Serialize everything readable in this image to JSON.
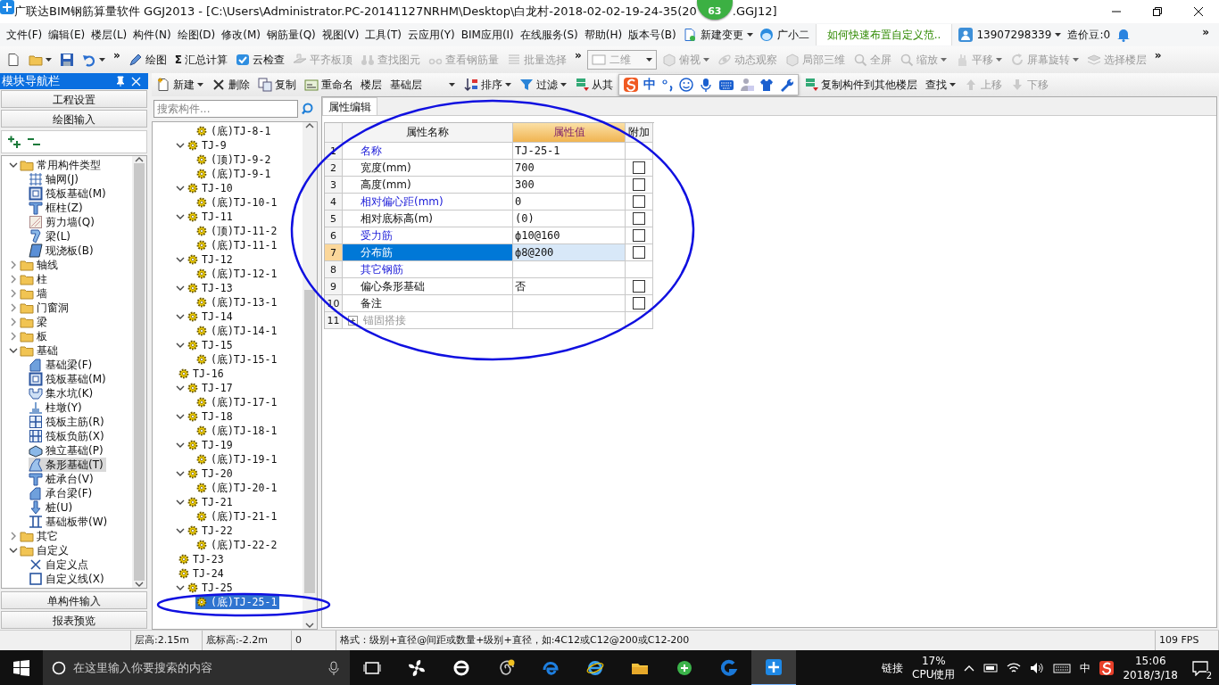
{
  "window": {
    "title": "广联达BIM钢筋算量软件 GGJ2013 - [C:\\Users\\Administrator.PC-20141127NRHM\\Desktop\\白龙村-2018-02-02-19-24-35(20",
    "title_end": ".GGJ12]",
    "badge": "63"
  },
  "menu": {
    "items": [
      "文件(F)",
      "编辑(E)",
      "楼层(L)",
      "构件(N)",
      "绘图(D)",
      "修改(M)",
      "钢筋量(Q)",
      "视图(V)",
      "工具(T)",
      "云应用(Y)",
      "BIM应用(I)",
      "在线服务(S)",
      "帮助(H)",
      "版本号(B)"
    ],
    "change_button": "新建变更",
    "assistant": "广小二",
    "tip": "如何快速布置自定义范..",
    "account": "13907298339",
    "beans": "造价豆:0",
    "overflow": "»"
  },
  "toolbar": {
    "items": [
      {
        "kind": "icon",
        "dropdown": false,
        "disabled": false
      },
      {
        "kind": "icon",
        "dropdown": true,
        "disabled": false
      },
      {
        "kind": "icon",
        "dropdown": false,
        "disabled": false
      },
      {
        "kind": "icon",
        "dropdown": true,
        "disabled": false
      },
      {
        "kind": "more",
        "label": "»"
      },
      {
        "kind": "button",
        "label": "绘图",
        "dropdown": false,
        "disabled": false
      },
      {
        "kind": "button",
        "symbol": "Σ",
        "label": "汇总计算",
        "dropdown": false,
        "disabled": false
      },
      {
        "kind": "button",
        "label": "云检查",
        "dropdown": false,
        "disabled": false
      },
      {
        "kind": "button",
        "label": "平齐板顶",
        "dropdown": false,
        "disabled": true
      },
      {
        "kind": "button",
        "label": "查找图元",
        "dropdown": false,
        "disabled": true
      },
      {
        "kind": "button",
        "label": "查看钢筋量",
        "dropdown": false,
        "disabled": true
      },
      {
        "kind": "button",
        "label": "批量选择",
        "dropdown": false,
        "disabled": true
      },
      {
        "kind": "more",
        "label": "»"
      },
      {
        "kind": "select",
        "label": "二维",
        "disabled": true
      },
      {
        "kind": "button",
        "label": "俯视",
        "dropdown": true,
        "disabled": true
      },
      {
        "kind": "button",
        "label": "动态观察",
        "dropdown": false,
        "disabled": true
      },
      {
        "kind": "button",
        "label": "局部三维",
        "dropdown": false,
        "disabled": true
      },
      {
        "kind": "button",
        "label": "全屏",
        "dropdown": false,
        "disabled": true
      },
      {
        "kind": "button",
        "label": "缩放",
        "dropdown": true,
        "disabled": true
      },
      {
        "kind": "button",
        "label": "平移",
        "dropdown": true,
        "disabled": true
      },
      {
        "kind": "button",
        "label": "屏幕旋转",
        "dropdown": true,
        "disabled": true
      },
      {
        "kind": "button",
        "label": "选择楼层",
        "dropdown": false,
        "disabled": true
      },
      {
        "kind": "more",
        "label": "»"
      }
    ]
  },
  "nav": {
    "title": "模块导航栏",
    "sections": [
      "工程设置",
      "绘图输入"
    ],
    "tree": [
      {
        "label": "常用构件类型",
        "expanded": true,
        "selected": false,
        "children": [
          {
            "label": "轴网(J)",
            "selected": false
          },
          {
            "label": "筏板基础(M)",
            "selected": false
          },
          {
            "label": "框柱(Z)",
            "selected": false
          },
          {
            "label": "剪力墙(Q)",
            "selected": false
          },
          {
            "label": "梁(L)",
            "selected": false
          },
          {
            "label": "现浇板(B)",
            "selected": false
          }
        ]
      },
      {
        "label": "轴线",
        "expanded": false,
        "selected": false
      },
      {
        "label": "柱",
        "expanded": false,
        "selected": false
      },
      {
        "label": "墙",
        "expanded": false,
        "selected": false
      },
      {
        "label": "门窗洞",
        "expanded": false,
        "selected": false
      },
      {
        "label": "梁",
        "expanded": false,
        "selected": false
      },
      {
        "label": "板",
        "expanded": false,
        "selected": false
      },
      {
        "label": "基础",
        "expanded": true,
        "selected": false,
        "children": [
          {
            "label": "基础梁(F)",
            "selected": false
          },
          {
            "label": "筏板基础(M)",
            "selected": false
          },
          {
            "label": "集水坑(K)",
            "selected": false
          },
          {
            "label": "柱墩(Y)",
            "selected": false
          },
          {
            "label": "筏板主筋(R)",
            "selected": false
          },
          {
            "label": "筏板负筋(X)",
            "selected": false
          },
          {
            "label": "独立基础(P)",
            "selected": false
          },
          {
            "label": "条形基础(T)",
            "selected": true
          },
          {
            "label": "桩承台(V)",
            "selected": false
          },
          {
            "label": "承台梁(F)",
            "selected": false
          },
          {
            "label": "桩(U)",
            "selected": false
          },
          {
            "label": "基础板带(W)",
            "selected": false
          }
        ]
      },
      {
        "label": "其它",
        "expanded": false,
        "selected": false
      },
      {
        "label": "自定义",
        "expanded": true,
        "selected": false,
        "children": [
          {
            "label": "自定义点",
            "selected": false
          },
          {
            "label": "自定义线(X)",
            "selected": false
          }
        ]
      }
    ],
    "bottom": [
      "单构件输入",
      "报表预览"
    ]
  },
  "components": {
    "toolbar": [
      {
        "kind": "button",
        "label": "新建",
        "dropdown": true,
        "disabled": false
      },
      {
        "kind": "button",
        "label": "删除",
        "dropdown": false,
        "disabled": false
      },
      {
        "kind": "button",
        "label": "复制",
        "dropdown": false,
        "disabled": false
      },
      {
        "kind": "button",
        "label": "重命名",
        "dropdown": false,
        "disabled": false
      },
      {
        "kind": "label",
        "label": "楼层"
      },
      {
        "kind": "floor",
        "label": "基础层"
      },
      {
        "kind": "button",
        "label": "排序",
        "dropdown": true,
        "disabled": false
      },
      {
        "kind": "button",
        "label": "过滤",
        "dropdown": true,
        "disabled": false
      },
      {
        "kind": "button",
        "label": "从其",
        "dropdown": false,
        "disabled": false
      },
      {
        "kind": "ime",
        "label": "中"
      },
      {
        "kind": "button",
        "label": "复制构件到其他楼层",
        "dropdown": false,
        "disabled": false
      },
      {
        "kind": "button",
        "label": "查找",
        "dropdown": true,
        "disabled": false
      },
      {
        "kind": "button",
        "label": "上移",
        "dropdown": false,
        "disabled": true
      },
      {
        "kind": "button",
        "label": "下移",
        "dropdown": false,
        "disabled": true
      }
    ],
    "search": {
      "placeholder": "搜索构件..."
    },
    "continued": [
      {
        "label": "(底)TJ-8-1",
        "selected": false
      }
    ],
    "nodes": [
      {
        "label": "TJ-9",
        "expanded": true,
        "selected": false,
        "children": [
          {
            "label": "(顶)TJ-9-2",
            "selected": false
          },
          {
            "label": "(底)TJ-9-1",
            "selected": false
          }
        ]
      },
      {
        "label": "TJ-10",
        "expanded": true,
        "selected": false,
        "children": [
          {
            "label": "(底)TJ-10-1",
            "selected": false
          }
        ]
      },
      {
        "label": "TJ-11",
        "expanded": true,
        "selected": false,
        "children": [
          {
            "label": "(顶)TJ-11-2",
            "selected": false
          },
          {
            "label": "(底)TJ-11-1",
            "selected": false
          }
        ]
      },
      {
        "label": "TJ-12",
        "expanded": true,
        "selected": false,
        "children": [
          {
            "label": "(底)TJ-12-1",
            "selected": false
          }
        ]
      },
      {
        "label": "TJ-13",
        "expanded": true,
        "selected": false,
        "children": [
          {
            "label": "(底)TJ-13-1",
            "selected": false
          }
        ]
      },
      {
        "label": "TJ-14",
        "expanded": true,
        "selected": false,
        "children": [
          {
            "label": "(底)TJ-14-1",
            "selected": false
          }
        ]
      },
      {
        "label": "TJ-15",
        "expanded": true,
        "selected": false,
        "children": [
          {
            "label": "(底)TJ-15-1",
            "selected": false
          }
        ]
      },
      {
        "label": "TJ-16",
        "selected": false
      },
      {
        "label": "TJ-17",
        "expanded": true,
        "selected": false,
        "children": [
          {
            "label": "(底)TJ-17-1",
            "selected": false
          }
        ]
      },
      {
        "label": "TJ-18",
        "expanded": true,
        "selected": false,
        "children": [
          {
            "label": "(底)TJ-18-1",
            "selected": false
          }
        ]
      },
      {
        "label": "TJ-19",
        "expanded": true,
        "selected": false,
        "children": [
          {
            "label": "(底)TJ-19-1",
            "selected": false
          }
        ]
      },
      {
        "label": "TJ-20",
        "expanded": true,
        "selected": false,
        "children": [
          {
            "label": "(底)TJ-20-1",
            "selected": false
          }
        ]
      },
      {
        "label": "TJ-21",
        "expanded": true,
        "selected": false,
        "children": [
          {
            "label": "(底)TJ-21-1",
            "selected": false
          }
        ]
      },
      {
        "label": "TJ-22",
        "expanded": true,
        "selected": false,
        "children": [
          {
            "label": "(底)TJ-22-2",
            "selected": false
          }
        ]
      },
      {
        "label": "TJ-23",
        "selected": false
      },
      {
        "label": "TJ-24",
        "selected": false
      },
      {
        "label": "TJ-25",
        "expanded": true,
        "selected": false,
        "children": [
          {
            "label": "(底)TJ-25-1",
            "selected": true
          }
        ]
      }
    ]
  },
  "properties": {
    "tab": "属性编辑",
    "columns": [
      "属性名称",
      "属性值",
      "附加"
    ],
    "rows": [
      {
        "num": "1",
        "kind": "field",
        "name": "名称",
        "value": "TJ-25-1",
        "public": true,
        "selected": false
      },
      {
        "num": "2",
        "kind": "field",
        "name": "宽度(mm)",
        "value": "700",
        "public": false,
        "selected": false,
        "checked": false
      },
      {
        "num": "3",
        "kind": "field",
        "name": "高度(mm)",
        "value": "300",
        "public": false,
        "selected": false,
        "checked": false
      },
      {
        "num": "4",
        "kind": "field",
        "name": "相对偏心距(mm)",
        "value": "0",
        "public": true,
        "selected": false,
        "checked": false
      },
      {
        "num": "5",
        "kind": "field",
        "name": "相对底标高(m)",
        "value": "(0)",
        "public": false,
        "selected": false,
        "checked": false
      },
      {
        "num": "6",
        "kind": "field",
        "name": "受力筋",
        "value": "ф10@160",
        "public": true,
        "selected": false,
        "checked": false
      },
      {
        "num": "7",
        "kind": "field",
        "name": "分布筋",
        "value": "ф8@200",
        "public": false,
        "selected": true,
        "checked": false
      },
      {
        "num": "8",
        "kind": "field",
        "name": "其它钢筋",
        "public": true,
        "selected": false
      },
      {
        "num": "9",
        "kind": "field",
        "name": "偏心条形基础",
        "value": "否",
        "public": false,
        "selected": false,
        "checked": false
      },
      {
        "num": "10",
        "kind": "field",
        "name": "备注",
        "public": false,
        "selected": false,
        "checked": false
      },
      {
        "num": "11",
        "kind": "group",
        "name": "锚固搭接",
        "selected": false,
        "expanded": false
      }
    ]
  },
  "status_bar": {
    "fields": [
      "层高:2.15m",
      "底标高:-2.2m",
      "0",
      "格式：级别+直径@间距或数量+级别+直径，如:4C12或C12@200或C12-200",
      "109 FPS"
    ]
  },
  "taskbar": {
    "search_placeholder": "在这里输入你要搜索的内容",
    "apps": [
      {
        "selected": false
      },
      {
        "selected": false
      },
      {
        "selected": false
      },
      {
        "selected": false
      },
      {
        "selected": false
      },
      {
        "selected": false
      },
      {
        "selected": false
      },
      {
        "selected": false
      },
      {
        "selected": false
      },
      {
        "selected": true
      }
    ],
    "links": "链接",
    "cpu": "17%",
    "cpu_label": "CPU使用",
    "ime": "中",
    "time": "15:06",
    "date": "2018/3/18",
    "notifications": "2"
  }
}
